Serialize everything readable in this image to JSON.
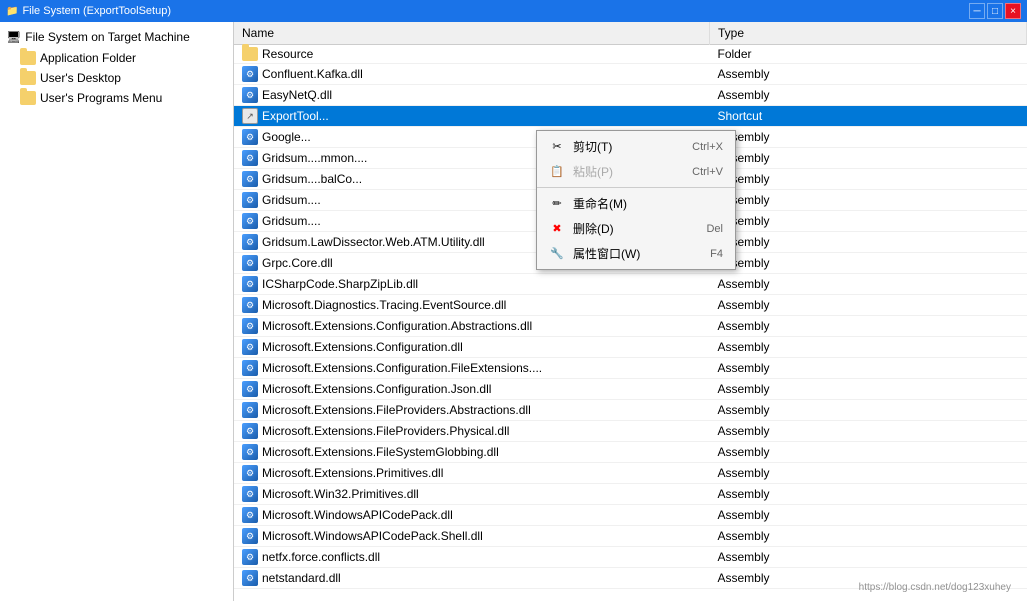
{
  "titleBar": {
    "title": "File System (ExportToolSetup)",
    "closeBtn": "×",
    "minBtn": "─",
    "maxBtn": "□"
  },
  "sidebar": {
    "rootLabel": "File System on Target Machine",
    "items": [
      {
        "label": "Application Folder",
        "type": "folder"
      },
      {
        "label": "User's Desktop",
        "type": "folder"
      },
      {
        "label": "User's Programs Menu",
        "type": "folder"
      }
    ]
  },
  "table": {
    "columns": [
      "Name",
      "Type"
    ],
    "rows": [
      {
        "name": "Resource",
        "type": "Folder",
        "icon": "folder"
      },
      {
        "name": "Confluent.Kafka.dll",
        "type": "Assembly",
        "icon": "assembly"
      },
      {
        "name": "EasyNetQ.dll",
        "type": "Assembly",
        "icon": "assembly"
      },
      {
        "name": "ExportTool...",
        "type": "Shortcut",
        "icon": "shortcut",
        "selected": true
      },
      {
        "name": "Google...",
        "type": "Assembly",
        "icon": "assembly"
      },
      {
        "name": "Gridsum....mmon....",
        "type": "Assembly",
        "icon": "assembly"
      },
      {
        "name": "Gridsum....balCo...",
        "type": "Assembly",
        "icon": "assembly"
      },
      {
        "name": "Gridsum....",
        "type": "Assembly",
        "icon": "assembly"
      },
      {
        "name": "Gridsum....",
        "type": "Assembly",
        "icon": "assembly"
      },
      {
        "name": "Gridsum.LawDissector.Web.ATM.Utility.dll",
        "type": "Assembly",
        "icon": "assembly"
      },
      {
        "name": "Grpc.Core.dll",
        "type": "Assembly",
        "icon": "assembly"
      },
      {
        "name": "ICSharpCode.SharpZipLib.dll",
        "type": "Assembly",
        "icon": "assembly"
      },
      {
        "name": "Microsoft.Diagnostics.Tracing.EventSource.dll",
        "type": "Assembly",
        "icon": "assembly"
      },
      {
        "name": "Microsoft.Extensions.Configuration.Abstractions.dll",
        "type": "Assembly",
        "icon": "assembly"
      },
      {
        "name": "Microsoft.Extensions.Configuration.dll",
        "type": "Assembly",
        "icon": "assembly"
      },
      {
        "name": "Microsoft.Extensions.Configuration.FileExtensions....",
        "type": "Assembly",
        "icon": "assembly"
      },
      {
        "name": "Microsoft.Extensions.Configuration.Json.dll",
        "type": "Assembly",
        "icon": "assembly"
      },
      {
        "name": "Microsoft.Extensions.FileProviders.Abstractions.dll",
        "type": "Assembly",
        "icon": "assembly"
      },
      {
        "name": "Microsoft.Extensions.FileProviders.Physical.dll",
        "type": "Assembly",
        "icon": "assembly"
      },
      {
        "name": "Microsoft.Extensions.FileSystemGlobbing.dll",
        "type": "Assembly",
        "icon": "assembly"
      },
      {
        "name": "Microsoft.Extensions.Primitives.dll",
        "type": "Assembly",
        "icon": "assembly"
      },
      {
        "name": "Microsoft.Win32.Primitives.dll",
        "type": "Assembly",
        "icon": "assembly"
      },
      {
        "name": "Microsoft.WindowsAPICodePack.dll",
        "type": "Assembly",
        "icon": "assembly"
      },
      {
        "name": "Microsoft.WindowsAPICodePack.Shell.dll",
        "type": "Assembly",
        "icon": "assembly"
      },
      {
        "name": "netfx.force.conflicts.dll",
        "type": "Assembly",
        "icon": "assembly"
      },
      {
        "name": "netstandard.dll",
        "type": "Assembly",
        "icon": "assembly"
      }
    ]
  },
  "contextMenu": {
    "items": [
      {
        "label": "剪切(T)",
        "shortcut": "Ctrl+X",
        "icon": "scissors",
        "type": "action"
      },
      {
        "label": "粘贴(P)",
        "shortcut": "Ctrl+V",
        "icon": "paste",
        "type": "disabled"
      },
      {
        "separator": true
      },
      {
        "label": "重命名(M)",
        "shortcut": "",
        "icon": "rename",
        "type": "action"
      },
      {
        "label": "删除(D)",
        "shortcut": "Del",
        "icon": "delete",
        "type": "delete"
      },
      {
        "label": "属性窗口(W)",
        "shortcut": "F4",
        "icon": "properties",
        "type": "action"
      }
    ]
  },
  "watermark": "https://blog.csdn.net/dog123xuhey"
}
